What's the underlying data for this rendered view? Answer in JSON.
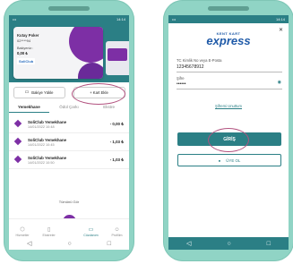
{
  "status_time": "14:14",
  "left": {
    "card": {
      "name": "Kutay Poker",
      "number": "02****94",
      "balance_label": "Bakiyeniz :",
      "balance": "0,00 ₺",
      "logo": "SoliClub"
    },
    "buttons": {
      "balance": "Bakiye Yükle",
      "add_card": "+ Kart Ekle"
    },
    "tabs": [
      "Yemekhane",
      "Ödül Çarkı",
      "Ekstre"
    ],
    "transactions": [
      {
        "name": "SoliClub Yemekhane",
        "date": "14/01/2022 10:48",
        "amount": "- 0,00 ₺"
      },
      {
        "name": "SoliClub Yemekhane",
        "date": "14/01/2022 10:45",
        "amount": "- 1,03 ₺"
      },
      {
        "name": "SoliClub Yemekhane",
        "date": "14/01/2022 10:50",
        "amount": "- 1,03 ₺"
      }
    ],
    "see_all": "Tümünü Gör",
    "nav": [
      "Hizmetler",
      "Ekstreler",
      "",
      "Cüzdanım",
      "Profilim"
    ]
  },
  "right": {
    "brand_pre": "KENT KART",
    "brand_main": "express",
    "id_label": "TC Kimlik No veya E-Posta",
    "id_value": "12345678912",
    "pw_label": "Şifre",
    "pw_value": "••••••",
    "forgot": "Şifremi Unuttum",
    "login": "GİRİŞ",
    "register": "ÜYE OL"
  },
  "colors": {
    "accent": "#2b7f85",
    "brand_purple": "#7d2fa5",
    "frame": "#90d4c5",
    "annotation": "#b2527f"
  }
}
